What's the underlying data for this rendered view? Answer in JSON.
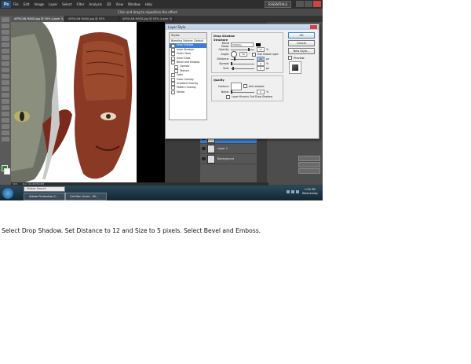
{
  "app": {
    "logo": "Ps",
    "menu": [
      "File",
      "Edit",
      "Image",
      "Layer",
      "Select",
      "Filter",
      "Analysis",
      "3D",
      "View",
      "Window",
      "Help"
    ],
    "workspace": "ESSENTIALS",
    "options_hint": "Click and drag to reposition the effect.",
    "tabs": [
      "AFRICAN MASK.jpg @ 50% (Layer 3, RGB/8#)",
      "AFRICAN MASK.jpg @ 50%",
      "AFRICAN MASK.jpg @ 50% (Layer 3)"
    ]
  },
  "dialog": {
    "title": "Layer Style",
    "styles_header": "Styles",
    "styles": [
      {
        "label": "Blending Options: Default",
        "checkbox": false,
        "selected": false,
        "sub": false
      },
      {
        "label": "Drop Shadow",
        "checkbox": true,
        "selected": true,
        "sub": false
      },
      {
        "label": "Inner Shadow",
        "checkbox": true,
        "selected": false,
        "sub": false
      },
      {
        "label": "Outer Glow",
        "checkbox": true,
        "selected": false,
        "sub": false
      },
      {
        "label": "Inner Glow",
        "checkbox": true,
        "selected": false,
        "sub": false
      },
      {
        "label": "Bevel and Emboss",
        "checkbox": true,
        "selected": false,
        "sub": false
      },
      {
        "label": "Contour",
        "checkbox": true,
        "selected": false,
        "sub": true
      },
      {
        "label": "Texture",
        "checkbox": true,
        "selected": false,
        "sub": true
      },
      {
        "label": "Satin",
        "checkbox": true,
        "selected": false,
        "sub": false
      },
      {
        "label": "Color Overlay",
        "checkbox": true,
        "selected": false,
        "sub": false
      },
      {
        "label": "Gradient Overlay",
        "checkbox": true,
        "selected": false,
        "sub": false
      },
      {
        "label": "Pattern Overlay",
        "checkbox": true,
        "selected": false,
        "sub": false
      },
      {
        "label": "Stroke",
        "checkbox": true,
        "selected": false,
        "sub": false
      }
    ],
    "section_title": "Drop Shadow",
    "structure_label": "Structure",
    "blend_mode_label": "Blend Mode:",
    "blend_mode_value": "Multiply",
    "opacity_label": "Opacity:",
    "opacity_value": "75",
    "angle_label": "Angle:",
    "angle_value": "30",
    "global_light_label": "Use Global Light",
    "distance_label": "Distance:",
    "distance_value": "12",
    "spread_label": "Spread:",
    "spread_value": "0",
    "size_label": "Size:",
    "size_value": "5",
    "px_unit": "px",
    "pct_unit": "%",
    "deg_unit": "°",
    "quality_label": "Quality",
    "contour_label": "Contour:",
    "anti_aliased_label": "Anti-aliased",
    "noise_label": "Noise:",
    "noise_value": "0",
    "knockout_label": "Layer Knocks Out Drop Shadow",
    "buttons": {
      "ok": "OK",
      "cancel": "Cancel",
      "new_style": "New Style...",
      "preview": "Preview"
    }
  },
  "layers": [
    {
      "name": "Layer 3",
      "active": true
    },
    {
      "name": "Layer 1",
      "active": false
    },
    {
      "name": "Background",
      "active": false
    }
  ],
  "status": {
    "zoom": "50%",
    "doc": "Doc: 22.6M/59.8M"
  },
  "taskbar": {
    "search": "Videos Search",
    "tasks": [
      "Adobe Photoshop C...",
      "Cat Man Scare - Mi..."
    ],
    "time": "1:56 PM",
    "day": "Wednesday"
  },
  "caption": "Select Drop Shadow. Set Distance to 12 and Size to 5 pixels. Select Bevel and Emboss.",
  "colors": {
    "selection": "#3a7fd4",
    "foreground": "#1a8d1a"
  }
}
